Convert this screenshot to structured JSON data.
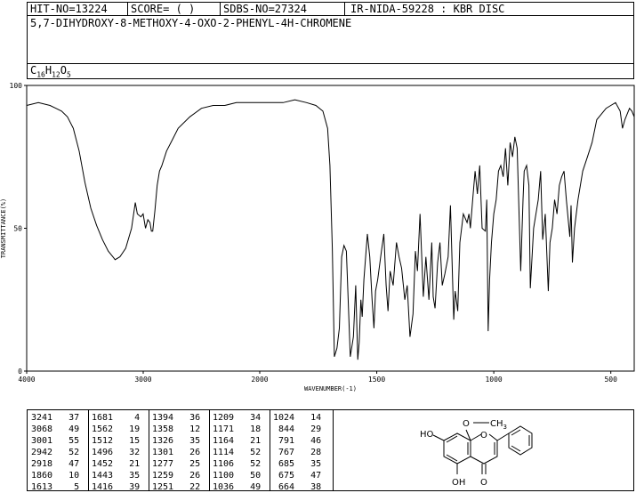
{
  "header": {
    "hit_no": "HIT-NO=13224",
    "score": "SCORE=  (  )",
    "sdbs_no": "SDBS-NO=27324",
    "ir_info": "IR-NIDA-59228 : KBR DISC",
    "compound_name": "5,7-DIHYDROXY-8-METHOXY-4-OXO-2-PHENYL-4H-CHROMENE",
    "formula": {
      "C": "C",
      "c_n": "16",
      "H": "H",
      "h_n": "12",
      "O": "O",
      "o_n": "5"
    }
  },
  "chart_data": {
    "type": "line",
    "xlabel": "WAVENUMBER(-1)",
    "ylabel": "TRANSMITTANCE(%)",
    "xlim": [
      4000,
      400
    ],
    "ylim": [
      0,
      100
    ],
    "x_ticks": [
      4000,
      3000,
      2000,
      1500,
      1000,
      500
    ],
    "y_ticks": [
      0,
      50,
      100
    ],
    "series": [
      {
        "x": [
          4000,
          3900,
          3800,
          3750,
          3700,
          3650,
          3600,
          3550,
          3500,
          3450,
          3400,
          3350,
          3300,
          3260,
          3241,
          3200,
          3150,
          3100,
          3068,
          3050,
          3020,
          3001,
          2980,
          2960,
          2942,
          2930,
          2918,
          2900,
          2880,
          2860,
          2840,
          2800,
          2750,
          2700,
          2600,
          2500,
          2400,
          2300,
          2200,
          2100,
          2000,
          1950,
          1900,
          1850,
          1800,
          1760,
          1730,
          1710,
          1700,
          1690,
          1681,
          1670,
          1660,
          1650,
          1640,
          1630,
          1613,
          1600,
          1590,
          1581,
          1575,
          1568,
          1562,
          1555,
          1540,
          1530,
          1520,
          1512,
          1505,
          1496,
          1480,
          1470,
          1460,
          1452,
          1443,
          1430,
          1416,
          1405,
          1394,
          1380,
          1370,
          1358,
          1345,
          1335,
          1326,
          1315,
          1301,
          1290,
          1277,
          1265,
          1259,
          1251,
          1240,
          1230,
          1220,
          1209,
          1195,
          1185,
          1171,
          1165,
          1160,
          1154,
          1145,
          1130,
          1114,
          1106,
          1100,
          1090,
          1080,
          1070,
          1060,
          1050,
          1036,
          1030,
          1024,
          1018,
          1010,
          1000,
          990,
          980,
          970,
          960,
          950,
          940,
          930,
          920,
          910,
          900,
          885,
          875,
          870,
          860,
          850,
          844,
          830,
          820,
          810,
          800,
          791,
          780,
          767,
          760,
          750,
          740,
          730,
          720,
          710,
          700,
          690,
          675,
          670,
          664,
          655,
          640,
          620,
          600,
          580,
          560,
          540,
          520,
          500,
          480,
          460,
          450,
          440,
          430,
          420,
          410,
          400
        ],
        "y": [
          93,
          94,
          93,
          92,
          91,
          89,
          85,
          77,
          66,
          57,
          51,
          46,
          42,
          40,
          39,
          40,
          43,
          50,
          59,
          55,
          54,
          55,
          50,
          53,
          52,
          49,
          49,
          56,
          65,
          70,
          72,
          77,
          81,
          85,
          89,
          92,
          93,
          93,
          94,
          94,
          94,
          94,
          94,
          95,
          94,
          93,
          91,
          85,
          72,
          43,
          5,
          8,
          15,
          40,
          44,
          42,
          5,
          12,
          30,
          4,
          10,
          25,
          19,
          32,
          48,
          40,
          25,
          15,
          28,
          32,
          42,
          48,
          30,
          21,
          35,
          30,
          45,
          40,
          36,
          25,
          30,
          12,
          20,
          42,
          35,
          55,
          26,
          40,
          25,
          45,
          26,
          22,
          38,
          45,
          30,
          34,
          40,
          58,
          18,
          28,
          25,
          21,
          45,
          55,
          52,
          55,
          50,
          60,
          70,
          62,
          72,
          50,
          49,
          60,
          14,
          32,
          45,
          55,
          60,
          70,
          72,
          68,
          78,
          65,
          80,
          75,
          82,
          78,
          35,
          60,
          70,
          72,
          65,
          29,
          50,
          55,
          60,
          70,
          46,
          55,
          28,
          45,
          50,
          60,
          55,
          65,
          68,
          70,
          60,
          47,
          58,
          38,
          50,
          60,
          70,
          75,
          80,
          88,
          90,
          92,
          93,
          94,
          91,
          85,
          88,
          90,
          92,
          91,
          89
        ]
      }
    ]
  },
  "peaks": [
    [
      "3241",
      "37"
    ],
    [
      "3068",
      "49"
    ],
    [
      "3001",
      "55"
    ],
    [
      "2942",
      "52"
    ],
    [
      "2918",
      "47"
    ],
    [
      "1860",
      "10"
    ],
    [
      "1613",
      "5"
    ],
    [
      "1681",
      "4"
    ],
    [
      "1562",
      "19"
    ],
    [
      "1512",
      "15"
    ],
    [
      "1496",
      "32"
    ],
    [
      "1452",
      "21"
    ],
    [
      "1443",
      "35"
    ],
    [
      "1416",
      "39"
    ],
    [
      "1394",
      "36"
    ],
    [
      "1358",
      "12"
    ],
    [
      "1326",
      "35"
    ],
    [
      "1301",
      "26"
    ],
    [
      "1277",
      "25"
    ],
    [
      "1259",
      "26"
    ],
    [
      "1251",
      "22"
    ],
    [
      "1209",
      "34"
    ],
    [
      "1171",
      "18"
    ],
    [
      "1164",
      "21"
    ],
    [
      "1114",
      "52"
    ],
    [
      "1106",
      "52"
    ],
    [
      "1100",
      "50"
    ],
    [
      "1036",
      "49"
    ],
    [
      "1024",
      "14"
    ],
    [
      "844",
      "29"
    ],
    [
      "791",
      "46"
    ],
    [
      "767",
      "28"
    ],
    [
      "685",
      "35"
    ],
    [
      "675",
      "47"
    ],
    [
      "664",
      "38"
    ]
  ],
  "structure_labels": {
    "ho1": "HO",
    "ho2": "OH",
    "o_ring": "O",
    "o_keto": "O",
    "o_me": "O",
    "ch3": "CH",
    "ch3_n": "3"
  }
}
